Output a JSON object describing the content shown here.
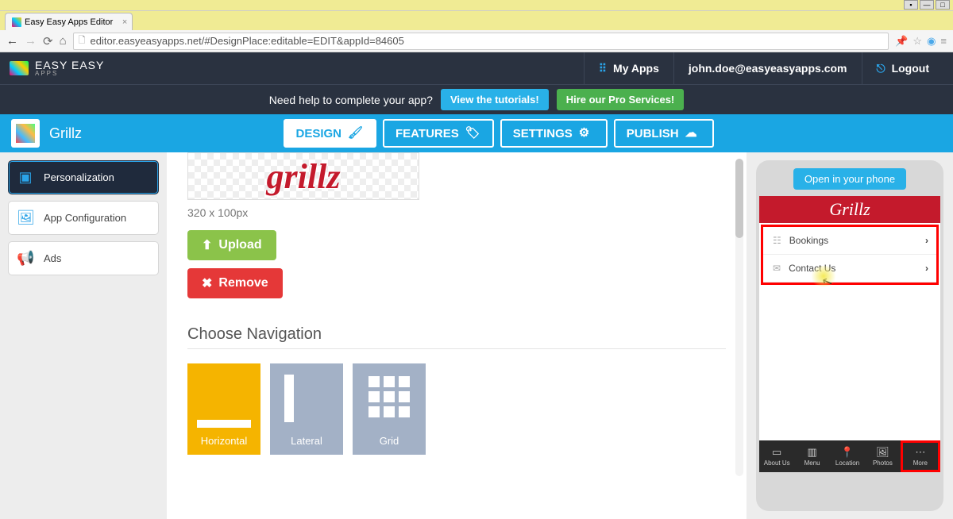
{
  "browser": {
    "tab_title": "Easy Easy Apps Editor",
    "url_host": "editor.easyeasyapps.net",
    "url_path": "/#DesignPlace:editable=EDIT&appId=84605"
  },
  "header": {
    "logo_main": "EASY EASY",
    "logo_sub": "APPS",
    "my_apps": "My Apps",
    "user_email": "john.doe@easyeasyapps.com",
    "logout": "Logout"
  },
  "help": {
    "text": "Need help to complete your app?",
    "tutorials": "View the tutorials!",
    "pro": "Hire our Pro Services!"
  },
  "bluebar": {
    "app_name": "Grillz",
    "tabs": {
      "design": "DESIGN",
      "features": "FEATURES",
      "settings": "SETTINGS",
      "publish": "PUBLISH"
    }
  },
  "sidebar": {
    "personalization": "Personalization",
    "app_config": "App Configuration",
    "ads": "Ads"
  },
  "main": {
    "logo_text": "grillz",
    "dimensions": "320 x 100px",
    "upload": "Upload",
    "remove": "Remove",
    "choose_nav": "Choose Navigation",
    "nav": {
      "horizontal": "Horizontal",
      "lateral": "Lateral",
      "grid": "Grid"
    }
  },
  "phone": {
    "open": "Open in your phone",
    "title": "Grillz",
    "rows": {
      "bookings": "Bookings",
      "contact": "Contact Us"
    },
    "tabs": {
      "about": "About Us",
      "menu": "Menu",
      "location": "Location",
      "photos": "Photos",
      "more": "More"
    }
  }
}
